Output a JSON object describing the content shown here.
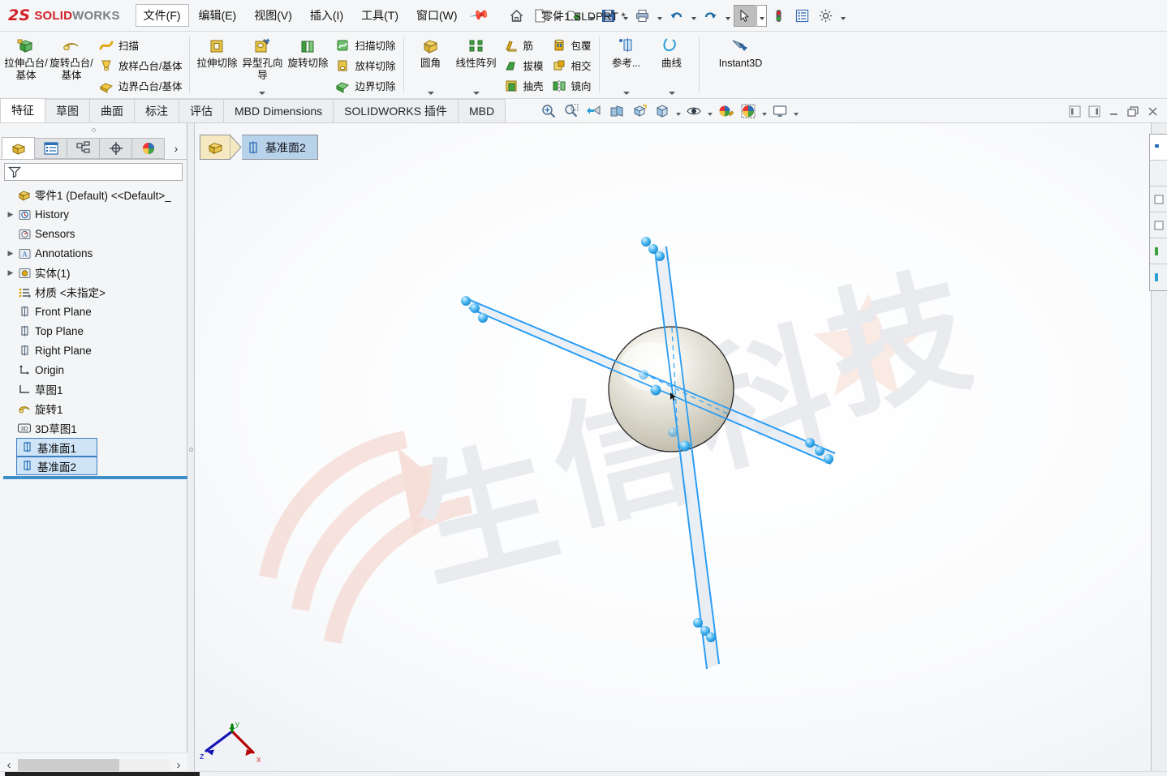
{
  "window": {
    "app_name_ds": "2S",
    "app_name_solid": "SOLID",
    "app_name_works": "WORKS",
    "document_title": "零件1.SLDPRT *"
  },
  "menu": {
    "items": [
      {
        "label": "文件(F)",
        "mnemonic": "F",
        "active": true
      },
      {
        "label": "编辑(E)",
        "mnemonic": "E",
        "active": false
      },
      {
        "label": "视图(V)",
        "mnemonic": "V",
        "active": false
      },
      {
        "label": "插入(I)",
        "mnemonic": "I",
        "active": false
      },
      {
        "label": "工具(T)",
        "mnemonic": "T",
        "active": false
      },
      {
        "label": "窗口(W)",
        "mnemonic": "W",
        "active": false
      }
    ],
    "pin_icon": "pin-icon"
  },
  "quick_toolbar": {
    "buttons": [
      {
        "name": "home-button",
        "icon": "home-icon",
        "caret": false,
        "selected": false
      },
      {
        "name": "new-document-button",
        "icon": "new-file-icon",
        "caret": true,
        "selected": false
      },
      {
        "name": "open-document-button",
        "icon": "open-folder-icon",
        "caret": true,
        "selected": false
      },
      {
        "name": "save-button",
        "icon": "save-disk-icon",
        "caret": true,
        "selected": false
      },
      {
        "name": "print-button",
        "icon": "printer-icon",
        "caret": true,
        "selected": false
      },
      {
        "name": "undo-button",
        "icon": "undo-arrow-icon",
        "caret": true,
        "selected": false
      },
      {
        "name": "redo-button",
        "icon": "redo-arrow-icon",
        "caret": true,
        "selected": false
      },
      {
        "name": "select-button",
        "icon": "cursor-arrow-icon",
        "caret": true,
        "selected": true
      },
      {
        "name": "rebuild-button",
        "icon": "traffic-light-icon",
        "caret": false,
        "selected": false
      },
      {
        "name": "file-properties-button",
        "icon": "properties-list-icon",
        "caret": false,
        "selected": false
      },
      {
        "name": "options-button",
        "icon": "gear-icon",
        "caret": true,
        "selected": false
      }
    ]
  },
  "ribbon": {
    "groups": [
      {
        "name": "boss-base-group",
        "big": [
          {
            "name": "extruded-boss-base",
            "label": "拉伸凸台/基体",
            "icon": "extrude-boss-icon"
          },
          {
            "name": "revolved-boss-base",
            "label": "旋转凸台/基体",
            "icon": "revolve-boss-icon"
          }
        ],
        "rows": [
          {
            "name": "swept-boss-base",
            "label": "扫描",
            "icon": "sweep-icon"
          },
          {
            "name": "lofted-boss-base",
            "label": "放样凸台/基体",
            "icon": "loft-icon"
          },
          {
            "name": "boundary-boss-base",
            "label": "边界凸台/基体",
            "icon": "boundary-icon"
          }
        ]
      },
      {
        "name": "cut-group",
        "big": [
          {
            "name": "extruded-cut",
            "label": "拉伸切除",
            "icon": "extrude-cut-icon"
          },
          {
            "name": "hole-wizard",
            "label": "异型孔向导",
            "icon": "hole-wizard-icon",
            "caret": true
          },
          {
            "name": "revolved-cut",
            "label": "旋转切除",
            "icon": "revolve-cut-icon"
          }
        ],
        "rows": [
          {
            "name": "swept-cut",
            "label": "扫描切除",
            "icon": "sweep-cut-icon"
          },
          {
            "name": "lofted-cut",
            "label": "放样切除",
            "icon": "loft-cut-icon"
          },
          {
            "name": "boundary-cut",
            "label": "边界切除",
            "icon": "boundary-cut-icon"
          }
        ]
      },
      {
        "name": "fillet-pattern-group",
        "big": [
          {
            "name": "fillet",
            "label": "圆角",
            "icon": "fillet-icon",
            "caret": true
          },
          {
            "name": "linear-pattern",
            "label": "线性阵列",
            "icon": "linear-pattern-icon",
            "caret": true
          }
        ],
        "rows": [
          {
            "name": "rib",
            "label": "筋",
            "icon": "rib-icon"
          },
          {
            "name": "draft",
            "label": "拔模",
            "icon": "draft-icon"
          },
          {
            "name": "shell",
            "label": "抽壳",
            "icon": "shell-icon"
          }
        ],
        "rows2": [
          {
            "name": "wrap",
            "label": "包覆",
            "icon": "wrap-icon"
          },
          {
            "name": "intersect",
            "label": "相交",
            "icon": "intersect-icon"
          },
          {
            "name": "mirror",
            "label": "镜向",
            "icon": "mirror-icon"
          }
        ]
      },
      {
        "name": "reference-curve-group",
        "big": [
          {
            "name": "reference-geometry",
            "label": "参考...",
            "icon": "reference-geometry-icon",
            "caret": true
          },
          {
            "name": "curves",
            "label": "曲线",
            "icon": "curves-icon",
            "caret": true
          }
        ]
      },
      {
        "name": "instant3d-group",
        "big": [
          {
            "name": "instant3d",
            "label": "Instant3D",
            "icon": "instant3d-icon"
          }
        ]
      }
    ]
  },
  "tabs": {
    "items": [
      {
        "label": "特征",
        "active": true
      },
      {
        "label": "草图",
        "active": false
      },
      {
        "label": "曲面",
        "active": false
      },
      {
        "label": "标注",
        "active": false
      },
      {
        "label": "评估",
        "active": false
      },
      {
        "label": "MBD Dimensions",
        "active": false
      },
      {
        "label": "SOLIDWORKS 插件",
        "active": false
      },
      {
        "label": "MBD",
        "active": false
      }
    ]
  },
  "view_toolbar": {
    "buttons": [
      {
        "name": "zoom-to-fit-button",
        "icon": "zoom-fit-icon",
        "caret": false
      },
      {
        "name": "zoom-to-area-button",
        "icon": "zoom-area-icon",
        "caret": false
      },
      {
        "name": "previous-view-button",
        "icon": "previous-view-icon",
        "caret": false
      },
      {
        "name": "section-view-button",
        "icon": "section-view-icon",
        "caret": false
      },
      {
        "name": "view-orientation-button",
        "icon": "view-orientation-icon",
        "caret": false
      },
      {
        "name": "display-style-button",
        "icon": "display-style-cube-icon",
        "caret": true
      },
      {
        "name": "hide-show-items-button",
        "icon": "hide-show-eye-icon",
        "caret": true
      },
      {
        "name": "edit-appearance-button",
        "icon": "appearance-pencil-icon",
        "caret": false
      },
      {
        "name": "apply-scene-button",
        "icon": "scene-icon",
        "caret": true
      },
      {
        "name": "view-settings-button",
        "icon": "monitor-icon",
        "caret": true
      }
    ]
  },
  "window_tools": {
    "buttons": [
      {
        "name": "collapse-left-button",
        "icon": "panel-left-icon"
      },
      {
        "name": "collapse-right-button",
        "icon": "panel-right-icon"
      },
      {
        "name": "minimize-button",
        "icon": "minimize-icon"
      },
      {
        "name": "restore-button",
        "icon": "restore-icon"
      }
    ]
  },
  "left_panel": {
    "tabs": [
      {
        "name": "feature-manager-tab",
        "icon": "feature-tree-icon",
        "active": true
      },
      {
        "name": "property-manager-tab",
        "icon": "property-list-icon",
        "active": false
      },
      {
        "name": "configuration-manager-tab",
        "icon": "configuration-icon",
        "active": false
      },
      {
        "name": "dimxpert-manager-tab",
        "icon": "dimxpert-target-icon",
        "active": false
      },
      {
        "name": "display-manager-tab",
        "icon": "display-sphere-icon",
        "active": false
      }
    ],
    "more_icon": "chevron-right-icon",
    "filter_icon": "filter-funnel-icon",
    "filter_placeholder": "",
    "tree": [
      {
        "label": "零件1 (Default) <<Default>_",
        "icon": "part-icon",
        "arrow": false,
        "indent": 0,
        "selected": false
      },
      {
        "label": "History",
        "icon": "history-icon",
        "arrow": true,
        "indent": 1,
        "selected": false
      },
      {
        "label": "Sensors",
        "icon": "sensors-icon",
        "arrow": false,
        "indent": 1,
        "selected": false
      },
      {
        "label": "Annotations",
        "icon": "annotations-icon",
        "arrow": true,
        "indent": 1,
        "selected": false
      },
      {
        "label": "实体(1)",
        "icon": "solid-bodies-icon",
        "arrow": true,
        "indent": 1,
        "selected": false
      },
      {
        "label": "材质 <未指定>",
        "icon": "material-icon",
        "arrow": false,
        "indent": 1,
        "selected": false
      },
      {
        "label": "Front Plane",
        "icon": "plane-icon",
        "arrow": false,
        "indent": 1,
        "selected": false
      },
      {
        "label": "Top Plane",
        "icon": "plane-icon",
        "arrow": false,
        "indent": 1,
        "selected": false
      },
      {
        "label": "Right Plane",
        "icon": "plane-icon",
        "arrow": false,
        "indent": 1,
        "selected": false
      },
      {
        "label": "Origin",
        "icon": "origin-icon",
        "arrow": false,
        "indent": 1,
        "selected": false
      },
      {
        "label": "草图1",
        "icon": "sketch-icon",
        "arrow": false,
        "indent": 1,
        "selected": false
      },
      {
        "label": "旋转1",
        "icon": "revolve-feature-icon",
        "arrow": false,
        "indent": 1,
        "selected": false
      },
      {
        "label": "3D草图1",
        "icon": "sketch3d-icon",
        "arrow": false,
        "indent": 1,
        "selected": false
      },
      {
        "label": "基准面1",
        "icon": "plane-icon",
        "arrow": false,
        "indent": 1,
        "selected": true
      },
      {
        "label": "基准面2",
        "icon": "plane-icon",
        "arrow": false,
        "indent": 1,
        "selected": true
      }
    ],
    "hscroll": {
      "left_arrow": "‹",
      "right_arrow": "›"
    }
  },
  "viewport": {
    "breadcrumb": {
      "part_icon": "part-icon",
      "item_icon": "plane-icon",
      "item_label": "基准面2"
    },
    "triad": {
      "x_label": "x",
      "y_label": "y",
      "z_label": "z",
      "x_color": "#c00000",
      "y_color": "#008000",
      "z_color": "#0000c0"
    },
    "watermark_text": "生信科技",
    "sketch_color": "#2a9df4",
    "model": {
      "type": "sphere",
      "highlight_color": "#ffffff",
      "body_color": "#d8d6cc"
    }
  },
  "task_pane": {
    "cells": [
      {
        "name": "task-pane-resources",
        "icon": "sw-resources-icon"
      },
      {
        "name": "task-pane-design-library",
        "icon": "design-library-icon"
      },
      {
        "name": "task-pane-file-explorer",
        "icon": "file-explorer-icon"
      },
      {
        "name": "task-pane-view-palette",
        "icon": "view-palette-icon"
      },
      {
        "name": "task-pane-appearances",
        "icon": "appearances-icon"
      },
      {
        "name": "task-pane-custom-properties",
        "icon": "custom-properties-icon"
      }
    ]
  }
}
